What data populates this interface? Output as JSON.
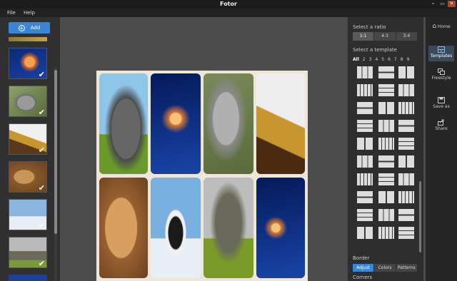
{
  "app": {
    "title": "Fotor"
  },
  "window_controls": {
    "minimize": "–",
    "restore": "▭",
    "close": "✕"
  },
  "menu": {
    "file": "File",
    "help": "Help"
  },
  "left_panel": {
    "add_label": "Add",
    "thumbnails": [
      {
        "subject": "jellyfish",
        "checked": true
      },
      {
        "subject": "koala",
        "checked": true
      },
      {
        "subject": "leopard",
        "checked": true
      },
      {
        "subject": "lions",
        "checked": true
      },
      {
        "subject": "penguins",
        "checked": true
      },
      {
        "subject": "elephant",
        "checked": true
      }
    ]
  },
  "collage": {
    "cells": [
      "elephant",
      "jellyfish",
      "koala",
      "leopard",
      "lions",
      "penguins",
      "elephant",
      "jellyfish"
    ]
  },
  "right_panel": {
    "ratio_heading": "Select a ratio",
    "ratios": [
      "1:1",
      "4:3",
      "3:4"
    ],
    "selected_ratio": "1:1",
    "template_heading": "Select a template",
    "template_filters": [
      "All",
      "2",
      "3",
      "4",
      "5",
      "6",
      "7",
      "8",
      "9"
    ],
    "selected_filter": "All",
    "border_heading": "Border",
    "border_tabs": [
      "Adjust",
      "Colors",
      "Patterns"
    ],
    "selected_border_tab": "Adjust",
    "corners_label": "Corners"
  },
  "sidebar": {
    "items": [
      {
        "label": "Home",
        "icon": "home-icon"
      },
      {
        "label": "Templates",
        "icon": "templates-icon",
        "selected": true
      },
      {
        "label": "Freestyle",
        "icon": "freestyle-icon"
      },
      {
        "label": "Save as",
        "icon": "save-icon"
      },
      {
        "label": "Share",
        "icon": "share-icon"
      }
    ]
  },
  "colors": {
    "accent": "#3a86d6",
    "canvas_bg": "#4c4c4c",
    "collage_bg": "#efe6da"
  }
}
